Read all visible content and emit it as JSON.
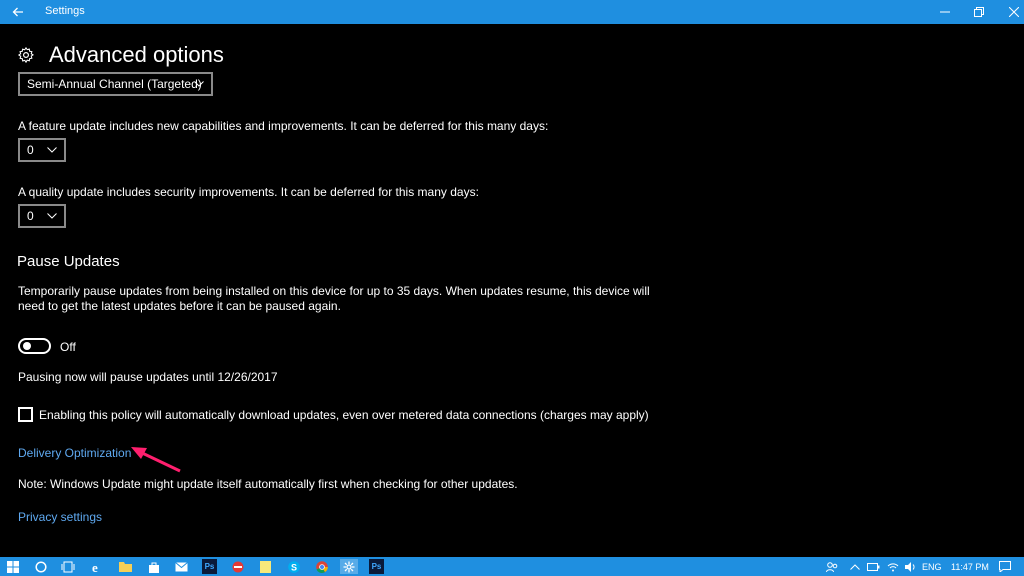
{
  "window": {
    "title": "Settings"
  },
  "page": {
    "title": "Advanced options"
  },
  "channel_select": {
    "value": "Semi-Annual Channel (Targeted)"
  },
  "feature_update": {
    "description": "A feature update includes new capabilities and improvements. It can be deferred for this many days:",
    "value": "0"
  },
  "quality_update": {
    "description": "A quality update includes security improvements. It can be deferred for this many days:",
    "value": "0"
  },
  "pause": {
    "heading": "Pause Updates",
    "description_line1": "Temporarily pause updates from being installed on this device for up to 35 days. When updates resume, this device will",
    "description_line2": "need to get the latest updates before it can be paused again.",
    "toggle_state": "Off",
    "note": "Pausing now will pause updates until 12/26/2017"
  },
  "metered": {
    "label": "Enabling this policy will automatically download updates, even over metered data connections (charges may apply)",
    "checked": false
  },
  "links": {
    "delivery_optimization": "Delivery Optimization",
    "privacy_settings": "Privacy settings"
  },
  "note": "Note: Windows Update might update itself automatically first when checking for other updates.",
  "taskbar": {
    "language": "ENG",
    "time": "11:47 PM",
    "icons": [
      "start-icon",
      "cortana-icon",
      "task-view-icon",
      "edge-icon",
      "file-explorer-icon",
      "store-icon",
      "mail-icon",
      "photoshop-icon",
      "media-icon",
      "sticky-notes-icon",
      "skype-icon",
      "chrome-icon",
      "settings-icon",
      "photoshop-icon"
    ]
  },
  "colors": {
    "accent": "#1f8fe0",
    "link": "#5fa9f0",
    "annotation_arrow": "#ff1f6e"
  }
}
